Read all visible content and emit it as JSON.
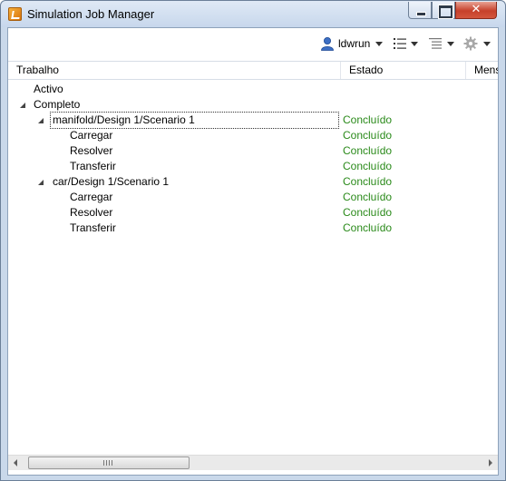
{
  "window": {
    "title": "Simulation Job Manager"
  },
  "toolbar": {
    "user_label": "ldwrun",
    "icons": [
      "user-icon",
      "list-view-icon",
      "indent-list-icon",
      "gear-icon"
    ]
  },
  "columns": [
    "Trabalho",
    "Estado",
    "Mens"
  ],
  "tree": {
    "rows": [
      {
        "name": "Activo",
        "status": ""
      },
      {
        "name": "Completo",
        "status": ""
      },
      {
        "name": "manifold/Design 1/Scenario 1",
        "status": "Concluído"
      },
      {
        "name": "Carregar",
        "status": "Concluído"
      },
      {
        "name": "Resolver",
        "status": "Concluído"
      },
      {
        "name": "Transferir",
        "status": "Concluído"
      },
      {
        "name": "car/Design 1/Scenario 1",
        "status": "Concluído"
      },
      {
        "name": "Carregar",
        "status": "Concluído"
      },
      {
        "name": "Resolver",
        "status": "Concluído"
      },
      {
        "name": "Transferir",
        "status": "Concluído"
      }
    ]
  },
  "colors": {
    "status_done": "#2a8a1a",
    "titlebar": "#c7d7ec",
    "close_button": "#c6402b"
  }
}
